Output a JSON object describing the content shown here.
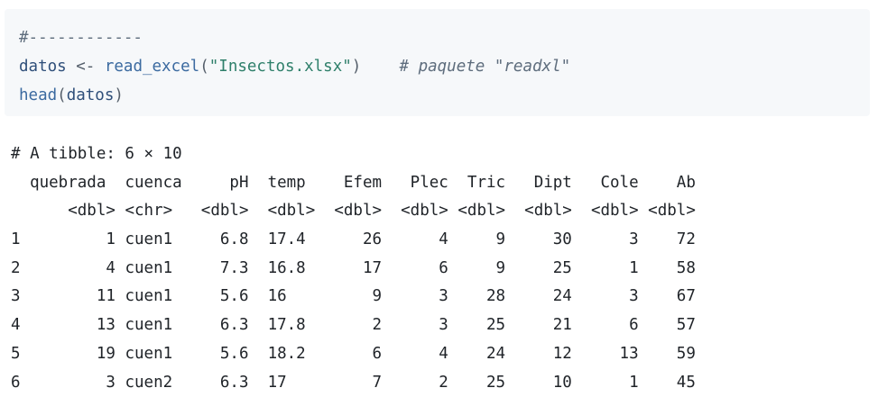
{
  "code": {
    "line1": "#------------",
    "line2_var": "datos",
    "line2_assign": " <- ",
    "line2_fn": "read_excel",
    "line2_open": "(",
    "line2_str": "\"Insectos.xlsx\"",
    "line2_close": ")",
    "line2_gap": "    ",
    "line2_comment": "# paquete \"readxl\"",
    "line3_fn": "head",
    "line3_open": "(",
    "line3_arg": "datos",
    "line3_close": ")"
  },
  "output": {
    "header": "# A tibble: 6 × 10",
    "columns": [
      "quebrada",
      "cuenca",
      "pH",
      "temp",
      "Efem",
      "Plec",
      "Tric",
      "Dipt",
      "Cole",
      "Ab"
    ],
    "types": [
      "<dbl>",
      "<chr>",
      "<dbl>",
      "<dbl>",
      "<dbl>",
      "<dbl>",
      "<dbl>",
      "<dbl>",
      "<dbl>",
      "<dbl>"
    ],
    "rows": [
      {
        "idx": "1",
        "cells": [
          "1",
          "cuen1",
          "6.8",
          "17.4",
          "26",
          "4",
          "9",
          "30",
          "3",
          "72"
        ]
      },
      {
        "idx": "2",
        "cells": [
          "4",
          "cuen1",
          "7.3",
          "16.8",
          "17",
          "6",
          "9",
          "25",
          "1",
          "58"
        ]
      },
      {
        "idx": "3",
        "cells": [
          "11",
          "cuen1",
          "5.6",
          "16",
          "9",
          "3",
          "28",
          "24",
          "3",
          "67"
        ]
      },
      {
        "idx": "4",
        "cells": [
          "13",
          "cuen1",
          "6.3",
          "17.8",
          "2",
          "3",
          "25",
          "21",
          "6",
          "57"
        ]
      },
      {
        "idx": "5",
        "cells": [
          "19",
          "cuen1",
          "5.6",
          "18.2",
          "6",
          "4",
          "24",
          "12",
          "13",
          "59"
        ]
      },
      {
        "idx": "6",
        "cells": [
          "3",
          "cuen2",
          "6.3",
          "17",
          "7",
          "2",
          "25",
          "10",
          "1",
          "45"
        ]
      }
    ]
  }
}
